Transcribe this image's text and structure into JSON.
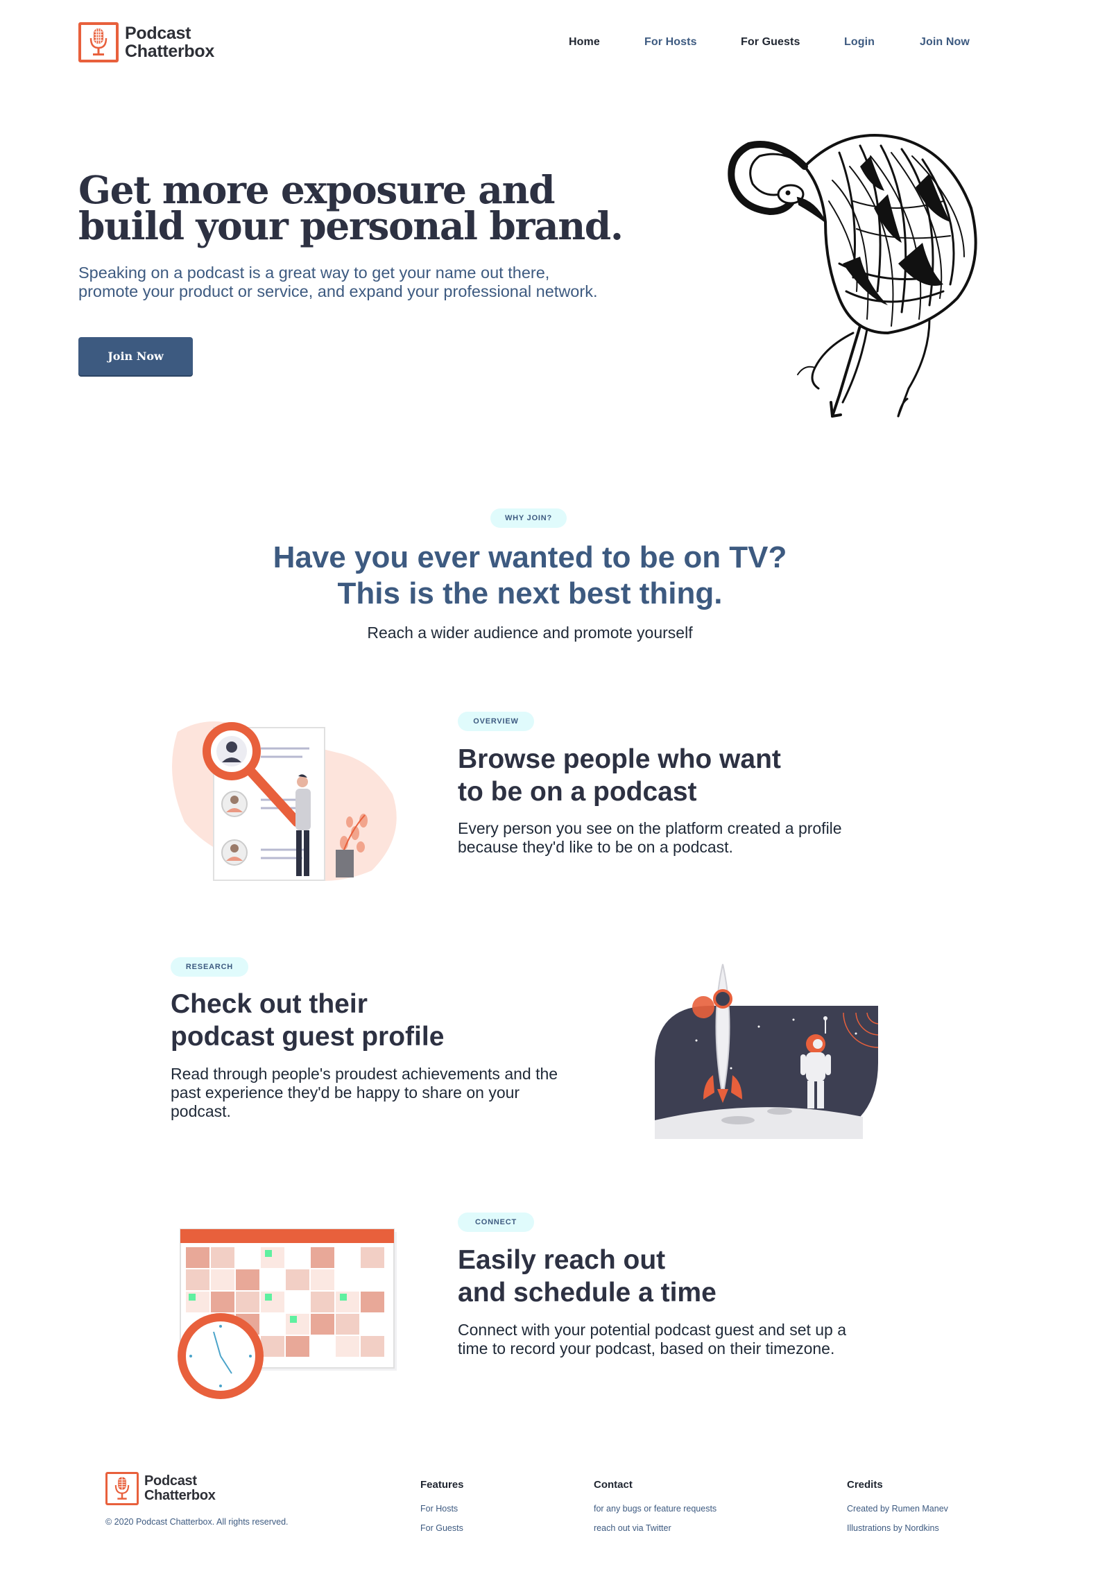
{
  "colors": {
    "accent": "#e8603c",
    "brand_blue": "#3d5a80",
    "pill_bg": "#e0fbfc",
    "dark": "#2d3142"
  },
  "logo": {
    "line1": "Podcast",
    "line2": "Chatterbox"
  },
  "nav": {
    "home": "Home",
    "for_hosts": "For Hosts",
    "for_guests": "For Guests",
    "login": "Login",
    "join_now": "Join Now"
  },
  "hero": {
    "title_line1": "Get more exposure and",
    "title_line2": "build your personal brand.",
    "subtitle_line1": "Speaking on a podcast is a great way to get your name out there,",
    "subtitle_line2": "promote your product or service, and expand your professional network.",
    "button": "Join Now",
    "illustration": "flamingo-sketch"
  },
  "why": {
    "pill": "WHY JOIN?",
    "title_line1": "Have you ever wanted to be on TV?",
    "title_line2": "This is the next best thing.",
    "subtitle": "Reach a wider audience and promote yourself"
  },
  "features": [
    {
      "pill": "OVERVIEW",
      "title_line1": "Browse people who want",
      "title_line2": "to be on a podcast",
      "text_line1": "Every person you see on the platform created a profile",
      "text_line2": "because they'd like to be on a podcast.",
      "text_line3": "",
      "illustration": "search-profiles"
    },
    {
      "pill": "RESEARCH",
      "title_line1": "Check out their",
      "title_line2": "podcast guest profile",
      "text_line1": "Read through people's proudest achievements and the",
      "text_line2": "past experience they'd be happy to share on your",
      "text_line3": "podcast.",
      "illustration": "astronaut-rocket"
    },
    {
      "pill": "CONNECT",
      "title_line1": "Easily reach out",
      "title_line2": "and schedule a time",
      "text_line1": "Connect with your potential podcast guest and set up a",
      "text_line2": "time to record your podcast, based on their timezone.",
      "text_line3": "",
      "illustration": "calendar-clock"
    }
  ],
  "footer": {
    "copyright": "© 2020 Podcast Chatterbox. All rights reserved.",
    "features": {
      "heading": "Features",
      "links": [
        "For Hosts",
        "For Guests"
      ]
    },
    "contact": {
      "heading": "Contact",
      "links": [
        "for any bugs or feature requests",
        "reach out via Twitter"
      ]
    },
    "credits": {
      "heading": "Credits",
      "links": [
        "Created by Rumen Manev",
        "Illustrations by Nordkins"
      ]
    }
  }
}
